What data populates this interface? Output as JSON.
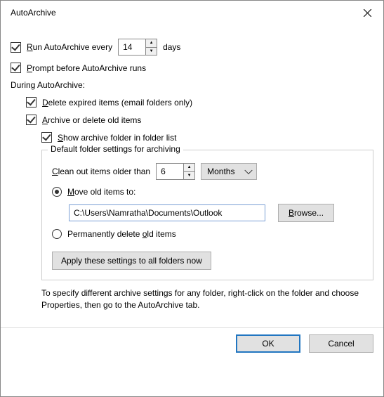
{
  "window": {
    "title": "AutoArchive"
  },
  "opts": {
    "run_every": {
      "checked": true,
      "label_prefix": "Run AutoArchive every",
      "value": "14",
      "label_suffix": "days"
    },
    "prompt": {
      "checked": true,
      "label": "Prompt before AutoArchive runs"
    },
    "during_heading": "During AutoArchive:",
    "delete_expired": {
      "checked": true,
      "label": "Delete expired items (email folders only)"
    },
    "archive_or_delete": {
      "checked": true,
      "label": "Archive or delete old items"
    },
    "show_folder": {
      "checked": true,
      "label": "Show archive folder in folder list"
    }
  },
  "group": {
    "legend": "Default folder settings for archiving",
    "clean_label": "Clean out items older than",
    "clean_value": "6",
    "clean_unit": "Months",
    "move": {
      "checked": true,
      "label": "Move old items to:",
      "path": "C:\\Users\\Namratha\\Documents\\Outlook",
      "browse": "Browse..."
    },
    "perm_delete": {
      "checked": false,
      "label": "Permanently delete old items"
    },
    "apply_btn": "Apply these settings to all folders now"
  },
  "help": "To specify different archive settings for any folder, right-click on the folder and choose Properties, then go to the AutoArchive tab.",
  "buttons": {
    "ok": "OK",
    "cancel": "Cancel"
  }
}
